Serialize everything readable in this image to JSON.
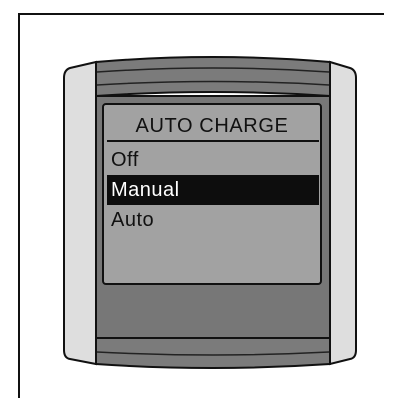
{
  "screen": {
    "title": "AUTO CHARGE"
  },
  "menu": {
    "items": [
      {
        "label": "Off",
        "selected": false
      },
      {
        "label": "Manual",
        "selected": true
      },
      {
        "label": "Auto",
        "selected": false
      }
    ]
  },
  "colors": {
    "screen_background": "#a2a2a2",
    "bezel": "#777777",
    "side_panel": "#dedede",
    "highlight": "#0d0d0d",
    "text": "#111111"
  }
}
